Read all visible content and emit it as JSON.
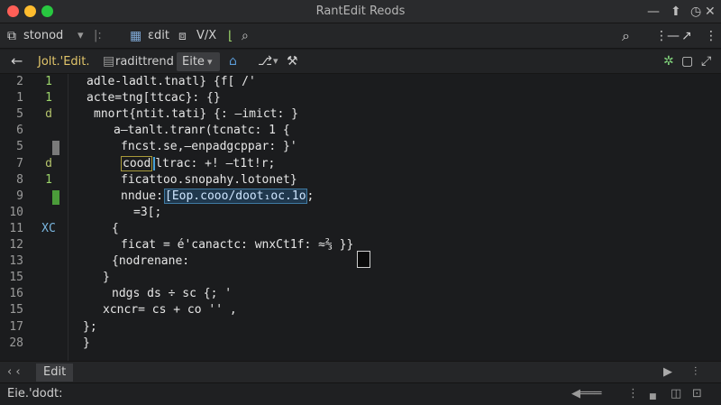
{
  "window": {
    "title": "RantEdit Reods",
    "lights": [
      "#ff5f57",
      "#febc2e",
      "#28c840"
    ],
    "controls": {
      "minimize": "—",
      "fullscreen": "⬆",
      "clock": "◷",
      "close": "✕"
    }
  },
  "toolbar1": {
    "project_select": "stonod",
    "project_chevron": "▾",
    "separator": "|:",
    "edit_label": "ɛdit",
    "extension": "V/X",
    "tools": [
      "⋮",
      "—",
      "↗",
      "⋮"
    ]
  },
  "toolbar2": {
    "file_label": "Jolt.'Edit.",
    "file_path": "radittrend",
    "mode": "Eite",
    "mode_chevron": "▾"
  },
  "gutter": {
    "line_numbers": [
      "2",
      "1",
      "5",
      "6",
      "5",
      "7",
      "8",
      "9",
      "10",
      "11",
      "12",
      "13",
      "15",
      "16",
      "15",
      "17",
      "28"
    ],
    "markers": [
      {
        "line": 0,
        "text": "1",
        "color": "#9bd36a"
      },
      {
        "line": 1,
        "text": "1",
        "color": "#9bd36a"
      },
      {
        "line": 2,
        "text": "d",
        "color": "#b5c46c"
      },
      {
        "line": 5,
        "text": "d",
        "color": "#b5c46c"
      },
      {
        "line": 6,
        "text": "1",
        "color": "#9bd36a"
      },
      {
        "line": 9,
        "text": "XC",
        "color": "#7ab6e0"
      }
    ]
  },
  "editor": {
    "lines": [
      "adle-ladlt.tnatl} {f[ /'",
      "acte=tng[ttcac}: {}",
      "mnort{ntit.tati} {: —imict: }",
      "a—tanlt.tranr(tcnatc: 1 {",
      "fncst.se,—enpadgcppar: }'",
      "",
      "ficattoo.snopahy.lotonet}",
      "nndue:",
      "=3[;",
      "{",
      "ficat = é'canactc: wnxCt1f: ≈⅔ }}",
      "{nodrenane:",
      "}",
      "ndgs ds ÷ sc {; '",
      "xcncr= cs + co '' ,",
      "};",
      "}"
    ],
    "tokens": {
      "coodl": "cood",
      "trac": "ltrac",
      "trac_tail": ": +! —t1t!r;",
      "selection": "[Eop.cooo/doot₁oc.1o",
      "selection_tail": ";"
    }
  },
  "bottombar": {
    "tab_label": "Edit",
    "nav_left": "‹ ‹",
    "play": "▶",
    "tools": "⫶"
  },
  "statusbar": {
    "left_text": "Eie.'dodt:",
    "icons": [
      "◀═══",
      "⋮",
      "■",
      "◫",
      "⊡"
    ]
  }
}
